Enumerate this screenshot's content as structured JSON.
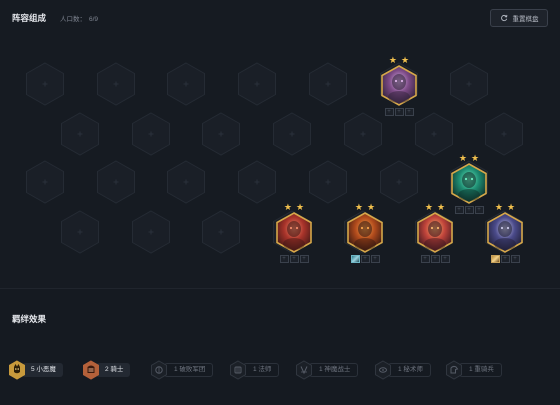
{
  "header": {
    "title": "阵容组成",
    "population_label": "人口数：",
    "population_value": "6/9",
    "reset_label": "重置棋盘"
  },
  "board": {
    "champions": [
      {
        "name": "champion-violet-mage",
        "stars": "★★",
        "items": [
          "+",
          "+",
          "+"
        ],
        "frame": "#d6a84a",
        "colors": [
          "#2a1f33",
          "#7c4a86",
          "#d9b0e6"
        ]
      },
      {
        "name": "champion-green-specter",
        "stars": "★★",
        "items": [
          "+",
          "+",
          "+"
        ],
        "frame": "#d6a84a",
        "colors": [
          "#0c2522",
          "#1e8c72",
          "#6ff0c2"
        ]
      },
      {
        "name": "champion-red-knight",
        "stars": "★★",
        "items": [
          "+",
          "+",
          "+"
        ],
        "frame": "#d6a84a",
        "colors": [
          "#3a1614",
          "#a8332a",
          "#f08a6a"
        ]
      },
      {
        "name": "champion-flame-devil",
        "stars": "★★",
        "items": [
          "item",
          "+",
          "+"
        ],
        "frame": "#d6a84a",
        "colors": [
          "#2b1410",
          "#b04a1c",
          "#f6a24a"
        ]
      },
      {
        "name": "champion-imp-girl",
        "stars": "★★",
        "items": [
          "+",
          "+",
          "+"
        ],
        "frame": "#d6a84a",
        "colors": [
          "#33141c",
          "#c1443b",
          "#f5b36b"
        ]
      },
      {
        "name": "champion-dark-knight",
        "stars": "★★",
        "items": [
          "item2",
          "+",
          "+"
        ],
        "frame": "#d6a84a",
        "colors": [
          "#1c1b2e",
          "#4a4a8a",
          "#c9c7e6"
        ]
      }
    ]
  },
  "synergies": {
    "title": "羁绊效果",
    "items": [
      {
        "label": "5 小恶魔",
        "active": true,
        "badge_color": "#c89a3c",
        "icon": "imp-icon"
      },
      {
        "label": "2 骑士",
        "active": true,
        "badge_color": "#b4613a",
        "icon": "knight-icon"
      },
      {
        "label": "1 破败军团",
        "active": false,
        "icon": "legion-icon"
      },
      {
        "label": "1 法师",
        "active": false,
        "icon": "mage-icon"
      },
      {
        "label": "1 神魔战士",
        "active": false,
        "icon": "warrior-icon"
      },
      {
        "label": "1 秘术师",
        "active": false,
        "icon": "mystic-icon"
      },
      {
        "label": "1 重骑兵",
        "active": false,
        "icon": "cavalry-icon"
      }
    ]
  }
}
